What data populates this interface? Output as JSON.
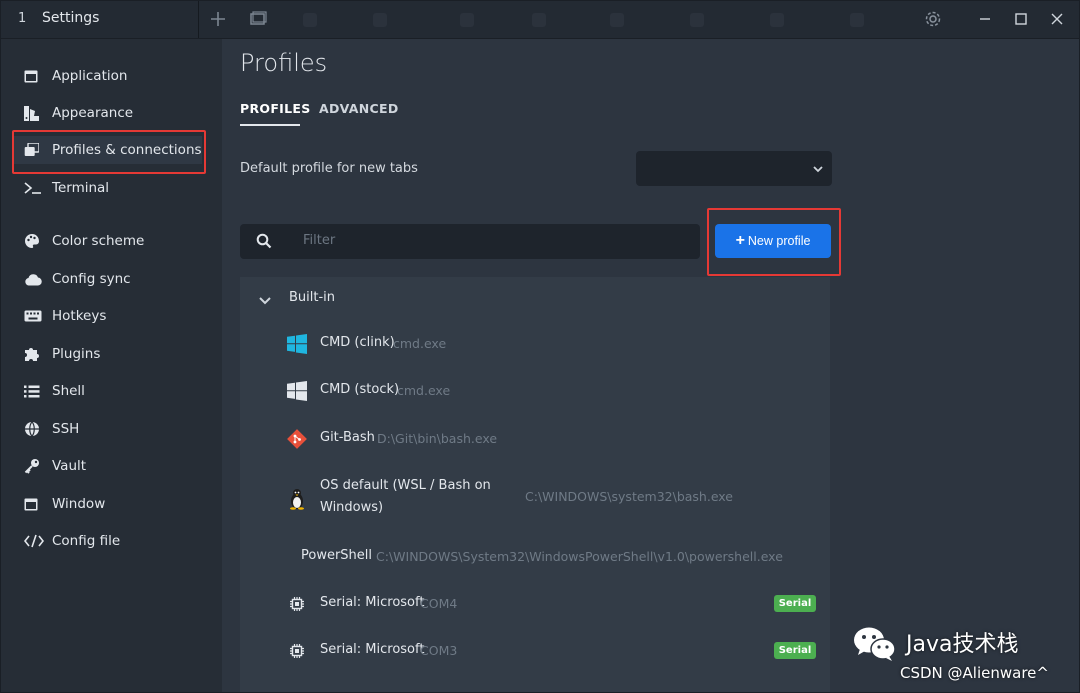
{
  "titlebar": {
    "tab_number": "1",
    "tab_title": "Settings",
    "icons": [
      "plus-icon",
      "window-icon",
      "gear-icon",
      "minimize-icon",
      "maximize-icon",
      "close-icon"
    ]
  },
  "sidebar": {
    "items": [
      {
        "label": "Application",
        "icon": "application-icon"
      },
      {
        "label": "Appearance",
        "icon": "appearance-icon"
      },
      {
        "label": "Profiles & connections",
        "icon": "profiles-icon",
        "active": true
      },
      {
        "label": "Terminal",
        "icon": "terminal-icon"
      },
      {
        "label": "Color scheme",
        "icon": "palette-icon"
      },
      {
        "label": "Config sync",
        "icon": "cloud-icon"
      },
      {
        "label": "Hotkeys",
        "icon": "keyboard-icon"
      },
      {
        "label": "Plugins",
        "icon": "puzzle-icon"
      },
      {
        "label": "Shell",
        "icon": "list-icon"
      },
      {
        "label": "SSH",
        "icon": "globe-icon"
      },
      {
        "label": "Vault",
        "icon": "key-icon"
      },
      {
        "label": "Window",
        "icon": "window-icon"
      },
      {
        "label": "Config file",
        "icon": "code-icon"
      }
    ]
  },
  "main": {
    "title": "Profiles",
    "tabs": [
      {
        "label": "PROFILES",
        "active": true
      },
      {
        "label": "ADVANCED"
      }
    ],
    "default_profile_label": "Default profile for new tabs",
    "default_profile_value": "",
    "filter_placeholder": "Filter",
    "new_profile_label": "New profile",
    "group_title": "Built-in",
    "profiles": [
      {
        "name": "CMD (clink)",
        "path": "cmd.exe",
        "icon": "windows-icon"
      },
      {
        "name": "CMD (stock)",
        "path": "cmd.exe",
        "icon": "windows-icon"
      },
      {
        "name": "Git-Bash",
        "path": "D:\\Git\\bin\\bash.exe",
        "icon": "git-icon"
      },
      {
        "name_line1": "OS default (WSL / Bash on",
        "name_line2": "Windows)",
        "path": "C:\\WINDOWS\\system32\\bash.exe",
        "icon": "linux-icon"
      },
      {
        "name": "PowerShell",
        "path": "C:\\WINDOWS\\System32\\WindowsPowerShell\\v1.0\\powershell.exe",
        "icon": ""
      },
      {
        "name": "Serial: Microsoft",
        "path": "COM4",
        "badge": "Serial",
        "icon": "chip-icon"
      },
      {
        "name": "Serial: Microsoft",
        "path": "COM3",
        "badge": "Serial",
        "icon": "chip-icon"
      }
    ]
  },
  "watermark": {
    "title": "Java技术栈",
    "subtitle": "CSDN @Alienware^"
  },
  "colors": {
    "accent": "#1a73e8",
    "badge": "#4caf50",
    "highlight": "#e53935"
  }
}
